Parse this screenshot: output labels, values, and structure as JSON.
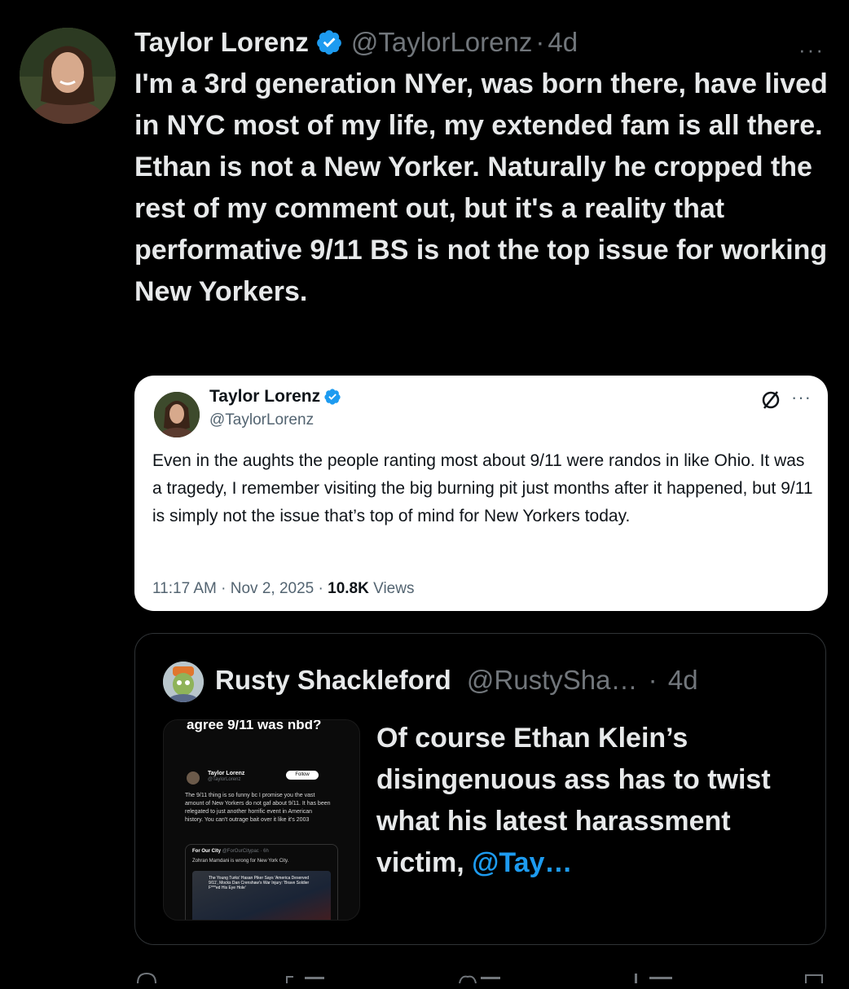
{
  "post": {
    "author_name": "Taylor Lorenz",
    "handle": "@TaylorLorenz",
    "separator": "·",
    "time": "4d",
    "more": "···",
    "text": "I'm a 3rd generation NYer, was born there, have lived in NYC most of my life, my extended fam is all there. Ethan is not a New Yorker. Naturally he cropped the rest of my comment out, but it's a reality that performative 9/11 BS is not the top issue for working New Yorkers."
  },
  "embedded_card": {
    "author_name": "Taylor Lorenz",
    "handle": "@TaylorLorenz",
    "more": "···",
    "text": "Even in the aughts the people ranting most about 9/11 were randos in like Ohio. It was a tragedy, I remember visiting the big burning pit just months after it happened, but 9/11 is simply not the issue that’s top of mind for New Yorkers today.",
    "time": "11:17 AM",
    "date": "Nov 2, 2025",
    "views_count": "10.8K",
    "views_label": "Views"
  },
  "quote": {
    "author_name": "Rusty Shackleford",
    "handle": "@RustySha…",
    "separator": "·",
    "time": "4d",
    "text_before": "Of course Ethan Klein’s disingenuous ass has to twist what his latest harassment victim, ",
    "mention": "@Tay…",
    "thumbnail": {
      "headline": "agree 9/11 was nbd?",
      "name": "Taylor Lorenz",
      "handle": "@TaylorLorenz",
      "follow": "Follow",
      "text": "The 9/11 thing is so funny bc I promise you the vast amount of New Yorkers do not gaf about 9/11. It has been relegated to just another horrific event in American history. You can't outrage bait over it like it's 2003",
      "sub_name": "For Our City",
      "sub_handle": "@ForOurCitypac · 6h",
      "sub_text": "Zohran Mamdani is wrong for New York City.",
      "image_caption": "The Young Turks' Hasan Piker Says 'America Deserved 9/11', Mocks Dan Crenshaw's War Injury: 'Brave Soldier F***ed His Eye Hole'"
    }
  },
  "colors": {
    "background": "#000000",
    "text": "#e7e9ea",
    "muted": "#71767b",
    "accent": "#1d9bf0"
  }
}
